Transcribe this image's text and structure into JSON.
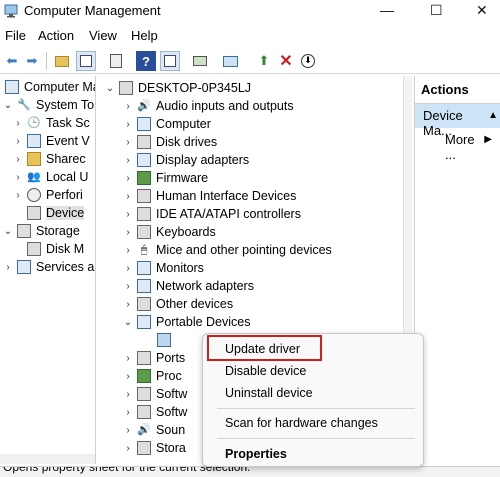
{
  "window": {
    "title": "Computer Management",
    "controls": [
      "—",
      "☐",
      "✕"
    ]
  },
  "menubar": [
    "File",
    "Action",
    "View",
    "Help"
  ],
  "left_tree": [
    {
      "label": "Computer Ma",
      "depth": 0,
      "expander": ""
    },
    {
      "label": "System To",
      "depth": 1,
      "expander": "⌄"
    },
    {
      "label": "Task Sc",
      "depth": 2,
      "expander": "›"
    },
    {
      "label": "Event V",
      "depth": 2,
      "expander": "›"
    },
    {
      "label": "Sharec",
      "depth": 2,
      "expander": "›"
    },
    {
      "label": "Local U",
      "depth": 2,
      "expander": "›"
    },
    {
      "label": "Perfori",
      "depth": 2,
      "expander": "›"
    },
    {
      "label": "Device",
      "depth": 2,
      "expander": ""
    },
    {
      "label": "Storage",
      "depth": 1,
      "expander": "⌄"
    },
    {
      "label": "Disk M",
      "depth": 2,
      "expander": ""
    },
    {
      "label": "Services ar",
      "depth": 1,
      "expander": "›"
    }
  ],
  "device_tree": {
    "root": "DESKTOP-0P345LJ",
    "items": [
      {
        "label": "Audio inputs and outputs",
        "exp": "›"
      },
      {
        "label": "Computer",
        "exp": "›"
      },
      {
        "label": "Disk drives",
        "exp": "›"
      },
      {
        "label": "Display adapters",
        "exp": "›"
      },
      {
        "label": "Firmware",
        "exp": "›"
      },
      {
        "label": "Human Interface Devices",
        "exp": "›"
      },
      {
        "label": "IDE ATA/ATAPI controllers",
        "exp": "›"
      },
      {
        "label": "Keyboards",
        "exp": "›"
      },
      {
        "label": "Mice and other pointing devices",
        "exp": "›"
      },
      {
        "label": "Monitors",
        "exp": "›"
      },
      {
        "label": "Network adapters",
        "exp": "›"
      },
      {
        "label": "Other devices",
        "exp": "›"
      },
      {
        "label": "Portable Devices",
        "exp": "⌄"
      }
    ],
    "after_items": [
      {
        "label": "Ports",
        "exp": "›"
      },
      {
        "label": "Proc",
        "exp": "›"
      },
      {
        "label": "Softw",
        "exp": "›"
      },
      {
        "label": "Softw",
        "exp": "›"
      },
      {
        "label": "Soun",
        "exp": "›"
      },
      {
        "label": "Stora",
        "exp": "›"
      }
    ]
  },
  "actions": {
    "header": "Actions",
    "selected": "Device Ma...",
    "more": "More ..."
  },
  "context_menu": {
    "items": [
      "Update driver",
      "Disable device",
      "Uninstall device",
      "Scan for hardware changes",
      "Properties"
    ],
    "highlighted": "Update driver"
  },
  "status": "Opens property sheet for the current selection."
}
